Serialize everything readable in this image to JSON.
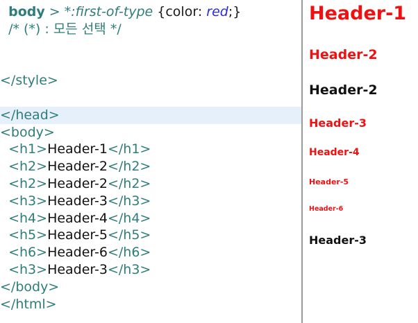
{
  "editor": {
    "lines": [
      {
        "parts": [
          {
            "t": "  ",
            "c": "txt"
          },
          {
            "t": "body",
            "c": "kw"
          },
          {
            "t": " > ",
            "c": "op"
          },
          {
            "t": "*:first-of-type",
            "c": "ital"
          },
          {
            "t": " {",
            "c": "brace"
          },
          {
            "t": "color",
            "c": "prop"
          },
          {
            "t": ": ",
            "c": "brace"
          },
          {
            "t": "red",
            "c": "val"
          },
          {
            "t": ";}",
            "c": "brace"
          }
        ]
      },
      {
        "parts": [
          {
            "t": "  /* (*) : ",
            "c": "comment"
          },
          {
            "t": "모든 선택",
            "c": "comment k"
          },
          {
            "t": " */",
            "c": "comment"
          }
        ]
      },
      {
        "parts": []
      },
      {
        "parts": []
      },
      {
        "parts": [
          {
            "t": "</style>",
            "c": "tag"
          }
        ]
      },
      {
        "parts": []
      },
      {
        "parts": [
          {
            "t": "</head>",
            "c": "tag"
          }
        ],
        "highlight": true
      },
      {
        "parts": [
          {
            "t": "<body>",
            "c": "tag"
          }
        ]
      },
      {
        "parts": [
          {
            "t": "  <h1>",
            "c": "tag"
          },
          {
            "t": "Header-1",
            "c": "txt"
          },
          {
            "t": "</h1>",
            "c": "tag"
          }
        ]
      },
      {
        "parts": [
          {
            "t": "  <h2>",
            "c": "tag"
          },
          {
            "t": "Header-2",
            "c": "txt"
          },
          {
            "t": "</h2>",
            "c": "tag"
          }
        ]
      },
      {
        "parts": [
          {
            "t": "  <h2>",
            "c": "tag"
          },
          {
            "t": "Header-2",
            "c": "txt"
          },
          {
            "t": "</h2>",
            "c": "tag"
          }
        ]
      },
      {
        "parts": [
          {
            "t": "  <h3>",
            "c": "tag"
          },
          {
            "t": "Header-3",
            "c": "txt"
          },
          {
            "t": "</h3>",
            "c": "tag"
          }
        ]
      },
      {
        "parts": [
          {
            "t": "  <h4>",
            "c": "tag"
          },
          {
            "t": "Header-4",
            "c": "txt"
          },
          {
            "t": "</h4>",
            "c": "tag"
          }
        ]
      },
      {
        "parts": [
          {
            "t": "  <h5>",
            "c": "tag"
          },
          {
            "t": "Header-5",
            "c": "txt"
          },
          {
            "t": "</h5>",
            "c": "tag"
          }
        ]
      },
      {
        "parts": [
          {
            "t": "  <h6>",
            "c": "tag"
          },
          {
            "t": "Header-6",
            "c": "txt"
          },
          {
            "t": "</h6>",
            "c": "tag"
          }
        ]
      },
      {
        "parts": [
          {
            "t": "  <h3>",
            "c": "tag"
          },
          {
            "t": "Header-3",
            "c": "txt"
          },
          {
            "t": "</h3>",
            "c": "tag"
          }
        ]
      },
      {
        "parts": [
          {
            "t": "</body>",
            "c": "tag"
          }
        ]
      },
      {
        "parts": [
          {
            "t": "</html>",
            "c": "tag"
          }
        ]
      }
    ]
  },
  "preview": {
    "h1": "Header-1",
    "h2a": "Header-2",
    "h2b": "Header-2",
    "h3a": "Header-3",
    "h4": "Header-4",
    "h5": "Header-5",
    "h6": "Header-6",
    "h3b": "Header-3"
  },
  "colors": {
    "first_of_type": "#ee1111",
    "normal": "#111111"
  }
}
